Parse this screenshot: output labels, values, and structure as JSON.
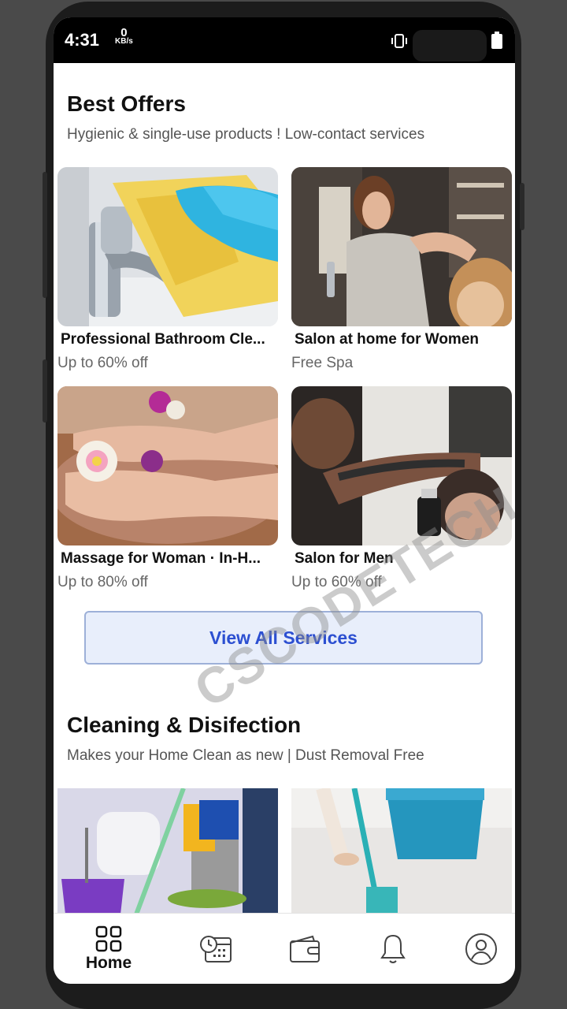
{
  "status": {
    "time": "4:31",
    "speed_value": "0",
    "speed_unit": "KB/s"
  },
  "best_offers": {
    "title": "Best Offers",
    "subtitle": "Hygienic & single-use products ! Low-contact services",
    "cards": [
      {
        "title": "Professional Bathroom Cle...",
        "subtitle": "Up to 60% off"
      },
      {
        "title": "Salon at home for Women",
        "subtitle": "Free Spa"
      },
      {
        "title": "Massage for Woman · In-H...",
        "subtitle": "Up to 80% off"
      },
      {
        "title": "Salon for Men",
        "subtitle": "Up to 60% off"
      }
    ],
    "view_all_label": "View All Services"
  },
  "cleaning": {
    "title": "Cleaning & Disifection",
    "subtitle": "Makes your Home Clean as new | Dust Removal Free"
  },
  "watermark": "CSCODETECH",
  "bottom_nav": {
    "items": [
      {
        "label": "Home",
        "icon": "grid-icon",
        "active": true
      },
      {
        "label": "",
        "icon": "calendar-clock-icon"
      },
      {
        "label": "",
        "icon": "wallet-icon"
      },
      {
        "label": "",
        "icon": "bell-icon"
      },
      {
        "label": "",
        "icon": "profile-icon"
      }
    ]
  },
  "colors": {
    "accent": "#2c4fd1",
    "button_bg": "#e8eefb",
    "button_border": "#9db0d8"
  }
}
